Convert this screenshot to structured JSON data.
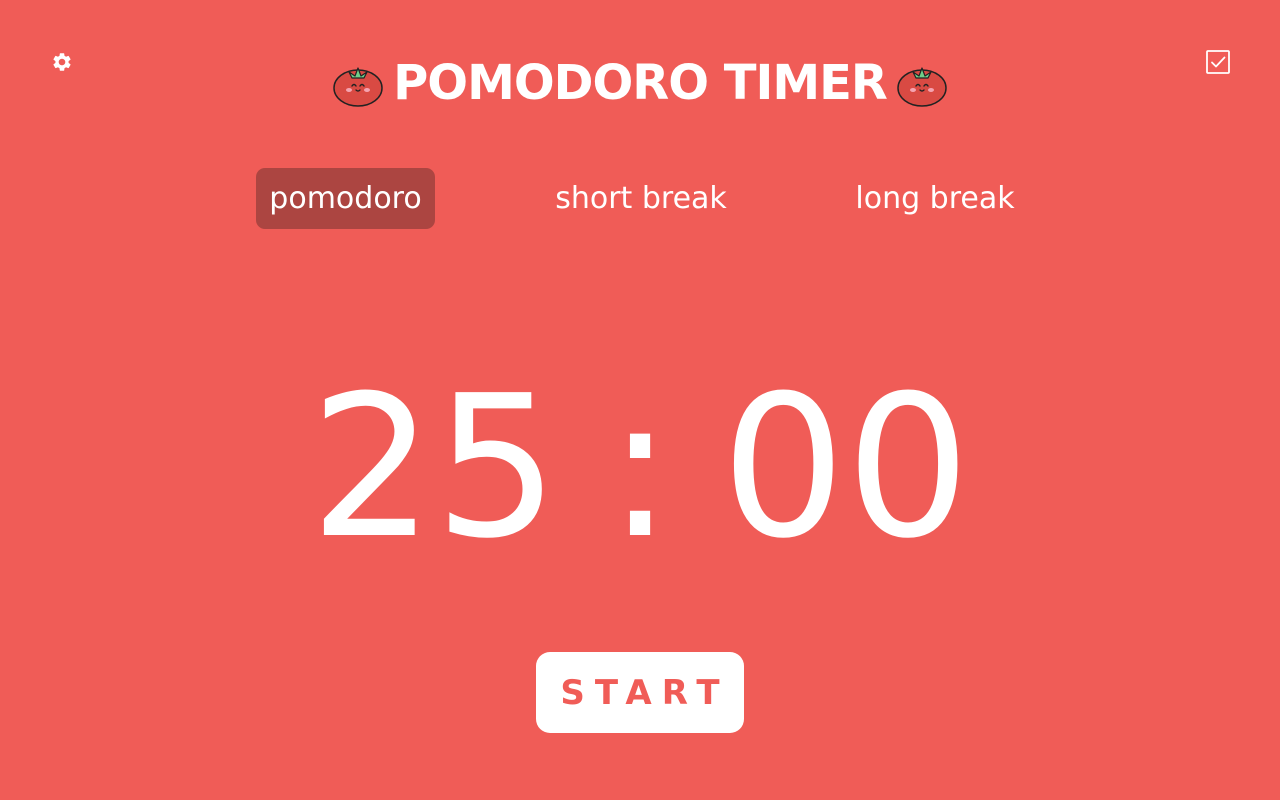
{
  "header": {
    "title": "POMODORO TIMER",
    "left_icon": "tomato-icon",
    "right_icon": "tomato-icon"
  },
  "toolbar": {
    "settings_icon": "gear-icon",
    "tasks_icon": "checkbox-icon"
  },
  "tabs": [
    {
      "label": "pomodoro",
      "active": true
    },
    {
      "label": "short break",
      "active": false
    },
    {
      "label": "long break",
      "active": false
    }
  ],
  "timer": {
    "minutes": "25",
    "separator": ":",
    "seconds": "00"
  },
  "start_button": {
    "label": "START"
  },
  "colors": {
    "background": "#f05c57",
    "active_tab": "#ac4541",
    "button_bg": "#ffffff",
    "button_text": "#f05c57"
  }
}
